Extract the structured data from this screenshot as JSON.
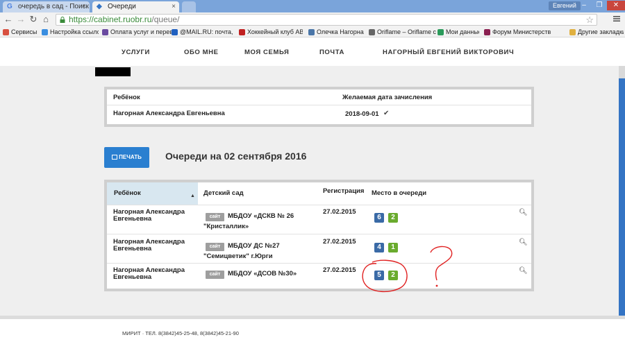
{
  "browser": {
    "tabs": [
      {
        "title": "очередь в сад - Поиск в"
      },
      {
        "title": "Очереди"
      }
    ],
    "user": "Евгений",
    "url_host": "https://cabinet.ruobr.ru",
    "url_path": "/queue/",
    "bookmarks": [
      "Сервисы",
      "Настройка ссылок",
      "Оплата услуг и перев",
      "@MAIL.RU: почта, по",
      "Хоккейный клуб АВ",
      "Олечка Нагорная",
      "Oriflame – Oriflame с",
      "Мои данные",
      "Форум Министерств",
      "Другие закладки"
    ]
  },
  "nav": {
    "items": [
      "УСЛУГИ",
      "ОБО МНЕ",
      "МОЯ СЕМЬЯ",
      "ПОЧТА",
      "НАГОРНЫЙ ЕВГЕНИЙ ВИКТОРОВИЧ"
    ]
  },
  "summary": {
    "col_child": "Ребёнок",
    "col_date": "Желаемая дата зачисления",
    "child": "Нагорная Александра Евгеньевна",
    "date": "2018-09-01"
  },
  "print_label": "ПЕЧАТЬ",
  "queue_title": "Очереди на 02 сентября 2016",
  "queue": {
    "headers": {
      "child": "Ребёнок",
      "kindergarten": "Детский сад",
      "registration": "Регистрация",
      "place": "Место в очереди"
    },
    "site_label": "сайт",
    "rows": [
      {
        "child_l1": "Нагорная Александра",
        "child_l2": "Евгеньевна",
        "kg_l1": "МБДОУ «ДСКВ № 26",
        "kg_l2": "\"Кристаллик»",
        "date": "27.02.2015",
        "place_a": "6",
        "place_b": "2"
      },
      {
        "child_l1": "Нагорная Александра",
        "child_l2": "Евгеньевна",
        "kg_l1": "МБДОУ ДС №27",
        "kg_l2": "\"Семицветик\" г.Юрги",
        "date": "27.02.2015",
        "place_a": "4",
        "place_b": "1"
      },
      {
        "child_l1": "Нагорная Александра",
        "child_l2": "Евгеньевна",
        "kg_l1": "МБДОУ «ДСОВ №30»",
        "kg_l2": "",
        "date": "27.02.2015",
        "place_a": "5",
        "place_b": "2"
      }
    ]
  },
  "footer": "МИРИТ · ТЕЛ. 8(3842)45-25-48, 8(3842)45-21-90",
  "colors": {
    "accent": "#2a7fd0",
    "badge_blue": "#3a6aa6",
    "badge_green": "#6aab2e",
    "annotation": "#e02020"
  }
}
